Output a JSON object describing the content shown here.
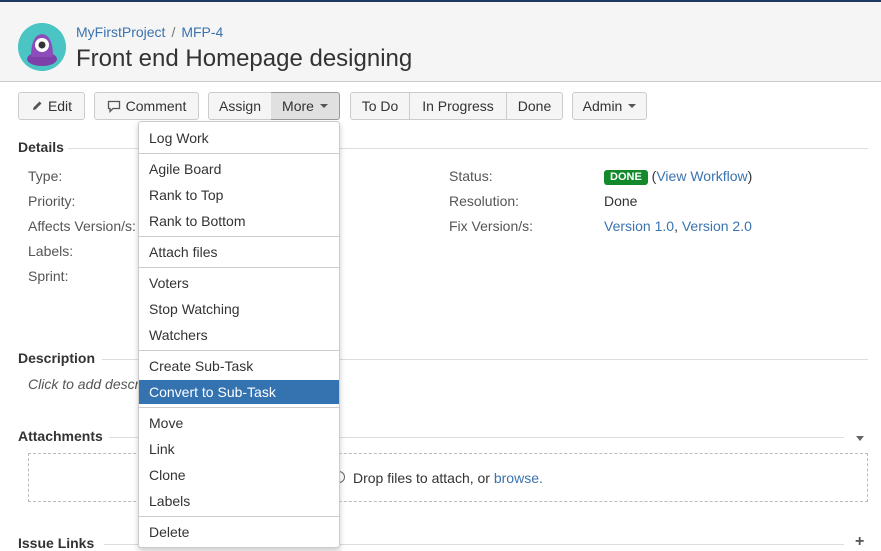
{
  "breadcrumb": {
    "project": "MyFirstProject",
    "separator": "/",
    "issue_key": "MFP-4"
  },
  "issue": {
    "title": "Front end Homepage designing"
  },
  "toolbar": {
    "edit": "Edit",
    "comment": "Comment",
    "assign": "Assign",
    "more": "More",
    "todo": "To Do",
    "in_progress": "In Progress",
    "done": "Done",
    "admin": "Admin"
  },
  "details": {
    "heading": "Details",
    "left_labels": [
      "Type:",
      "Priority:",
      "Affects Version/s:",
      "Labels:",
      "Sprint:"
    ],
    "status_label": "Status:",
    "status_badge": "DONE",
    "view_workflow": "View Workflow",
    "resolution_label": "Resolution:",
    "resolution_value": "Done",
    "fix_versions_label": "Fix Version/s:",
    "fix_version_1": "Version 1.0",
    "fix_version_2": "Version 2.0"
  },
  "description": {
    "heading": "Description",
    "placeholder": "Click to add description"
  },
  "attachments": {
    "heading": "Attachments",
    "drop_text": "Drop files to attach, or ",
    "browse_link": "browse."
  },
  "issue_links": {
    "heading": "Issue Links"
  },
  "more_menu": {
    "items": [
      "Log Work",
      "Agile Board",
      "Rank to Top",
      "Rank to Bottom",
      "Attach files",
      "Voters",
      "Stop Watching",
      "Watchers",
      "Create Sub-Task",
      "Convert to Sub-Task",
      "Move",
      "Link",
      "Clone",
      "Labels",
      "Delete"
    ],
    "selected": "Convert to Sub-Task"
  },
  "colors": {
    "link": "#3b73af",
    "done_badge": "#14892c",
    "menu_highlight": "#3572b0"
  }
}
